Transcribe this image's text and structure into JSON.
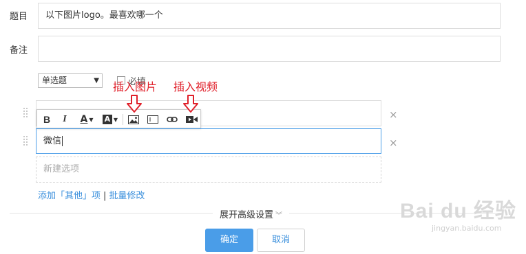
{
  "form": {
    "title_label": "题目",
    "title_value": "以下图片logo。最喜欢哪一个",
    "note_label": "备注",
    "note_value": "",
    "type_select": "单选题",
    "required_label": "必填"
  },
  "annotations": {
    "insert_image": "插入图片",
    "insert_video": "插入视频"
  },
  "options": {
    "option2_value": "微信",
    "new_option_placeholder": "新建选项",
    "add_other_link": "添加「其他」项",
    "batch_edit_link": "批量修改",
    "separator": "|"
  },
  "advanced": {
    "label": "展开高级设置"
  },
  "buttons": {
    "confirm": "确定",
    "cancel": "取消"
  },
  "watermark": {
    "brand": "Bai du 经验",
    "url": "jingyan.baidu.com"
  },
  "colors": {
    "accent": "#4a9de8",
    "annotation": "#e0202a",
    "link": "#3a8fdc"
  }
}
